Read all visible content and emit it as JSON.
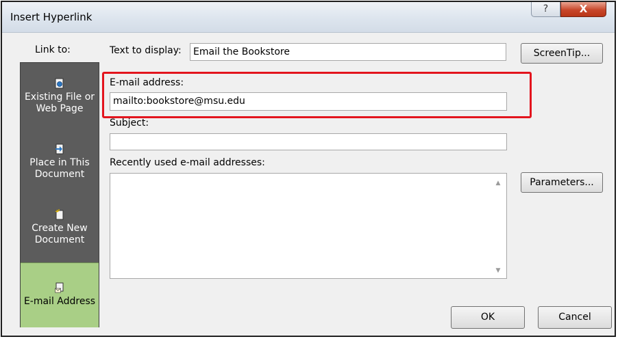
{
  "window": {
    "title": "Insert Hyperlink",
    "help_symbol": "?",
    "close_symbol": "X"
  },
  "sidebar": {
    "heading": "Link to:",
    "items": [
      {
        "label_line1": "Existing File or",
        "label_line2": "Web Page",
        "icon": "web-page-icon"
      },
      {
        "label_line1": "Place in This",
        "label_line2": "Document",
        "icon": "place-in-document-icon"
      },
      {
        "label_line1": "Create New",
        "label_line2": "Document",
        "icon": "new-document-icon"
      },
      {
        "label_line1": "E-mail Address",
        "label_line2": "",
        "icon": "email-address-icon",
        "selected": true
      }
    ]
  },
  "form": {
    "text_to_display_label": "Text to display:",
    "text_to_display_value": "Email the Bookstore",
    "email_label": "E-mail address:",
    "email_value": "mailto:bookstore@msu.edu",
    "subject_label": "Subject:",
    "subject_value": "",
    "recent_label": "Recently used e-mail addresses:",
    "recent_items": []
  },
  "buttons": {
    "screentip": "ScreenTip...",
    "parameters": "Parameters...",
    "ok": "OK",
    "cancel": "Cancel"
  },
  "colors": {
    "sidebar_bg": "#5c5c5c",
    "selected_bg": "#a9cf86",
    "highlight_border": "#e3141d",
    "close_button": "#c8472b"
  }
}
